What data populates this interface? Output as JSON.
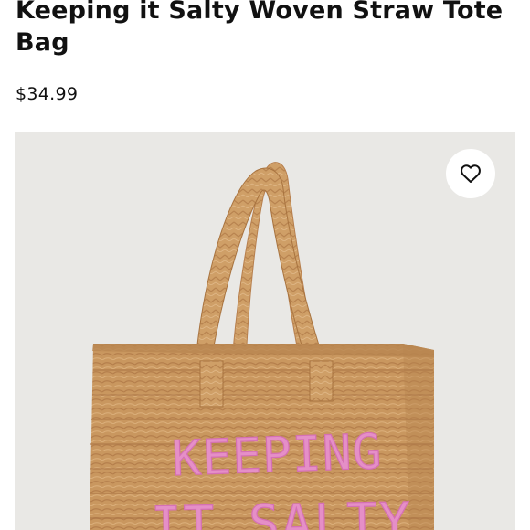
{
  "product": {
    "title": "Keeping it Salty Woven Straw Tote Bag",
    "price": "$34.99"
  },
  "image": {
    "subject": "woven straw tote bag",
    "embroidered_text_line1": "KEEPING",
    "embroidered_text_line2": "IT SALTY",
    "background_color": "#e9e8e5",
    "straw_color": "#c9975f",
    "embroidery_color": "#e58fc7"
  },
  "favorite": {
    "icon": "heart-outline-icon"
  }
}
